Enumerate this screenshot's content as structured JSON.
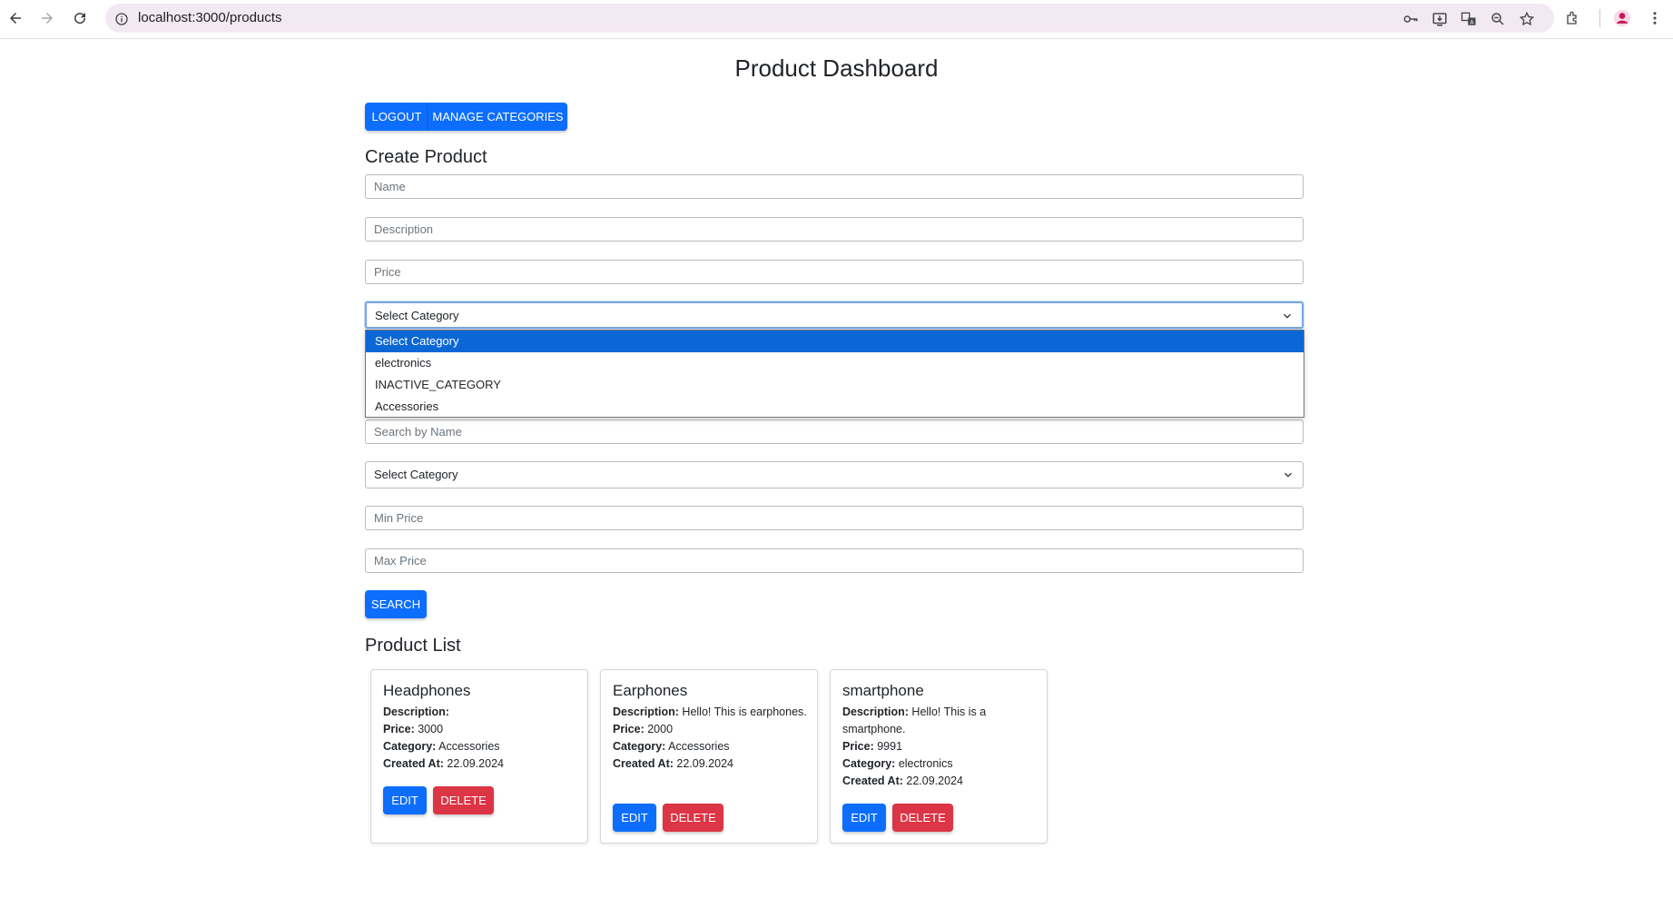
{
  "browser": {
    "url": "localhost:3000/products",
    "icons": [
      "back-icon",
      "forward-icon",
      "reload-icon",
      "site-info-icon",
      "key-icon",
      "install-app-icon",
      "translate-icon",
      "zoom-icon",
      "bookmark-star-icon",
      "extensions-icon",
      "profile-icon",
      "menu-icon"
    ]
  },
  "page": {
    "title": "Product Dashboard",
    "logout_label": "LOGOUT",
    "manage_categories_label": "MANAGE CATEGORIES"
  },
  "create_product": {
    "heading": "Create Product",
    "name_placeholder": "Name",
    "description_placeholder": "Description",
    "price_placeholder": "Price",
    "category_selected": "Select Category",
    "category_options": [
      "Select Category",
      "electronics",
      "INACTIVE_CATEGORY",
      "Accessories"
    ]
  },
  "search": {
    "name_placeholder": "Search by Name",
    "category_selected": "Select Category",
    "min_price_placeholder": "Min Price",
    "max_price_placeholder": "Max Price",
    "search_label": "SEARCH"
  },
  "product_list": {
    "heading": "Product List",
    "labels": {
      "description": "Description:",
      "price": "Price:",
      "category": "Category:",
      "created_at": "Created At:"
    },
    "edit_label": "EDIT",
    "delete_label": "DELETE",
    "products": [
      {
        "name": "Headphones",
        "description": "",
        "price": "3000",
        "category": "Accessories",
        "created_at": "22.09.2024"
      },
      {
        "name": "Earphones",
        "description": "Hello! This is earphones.",
        "price": "2000",
        "category": "Accessories",
        "created_at": "22.09.2024"
      },
      {
        "name": "smartphone",
        "description": "Hello! This is a smartphone.",
        "price": "9991",
        "category": "electronics",
        "created_at": "22.09.2024"
      }
    ]
  },
  "colors": {
    "primary": "#0d6efd",
    "danger": "#dc3545",
    "selected_option": "#0b67d6",
    "omnibox": "#f3e9f3",
    "profile": "#c2185b"
  }
}
